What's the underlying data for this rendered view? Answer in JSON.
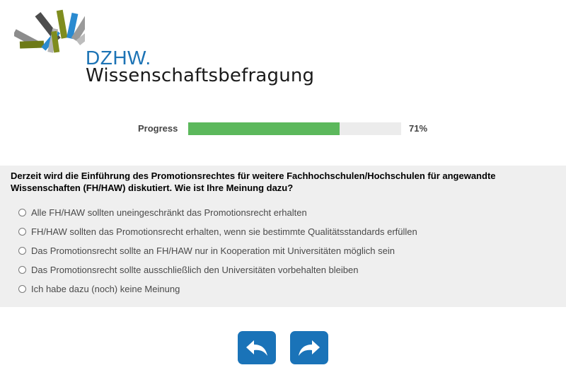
{
  "brand": {
    "short_name": "DZHW.",
    "subtitle": "Wissenschaftsbefragung",
    "color": "#1c73b5"
  },
  "progress": {
    "label": "Progress",
    "percent": 71,
    "value_text": "71%",
    "fill_color": "#5cb85c"
  },
  "question": {
    "text": "Derzeit wird die Einführung des Promotionsrechtes für weitere Fachhochschulen/Hochschulen für angewandte Wissenschaften (FH/HAW) diskutiert. Wie ist Ihre Meinung dazu?",
    "options": [
      {
        "label": "Alle FH/HAW sollten uneingeschränkt das Promotionsrecht erhalten"
      },
      {
        "label": "FH/HAW sollten das Promotionsrecht erhalten, wenn sie bestimmte Qualitätsstandards erfüllen"
      },
      {
        "label": "Das Promotionsrecht sollte an FH/HAW nur in Kooperation mit Universitäten möglich sein"
      },
      {
        "label": "Das Promotionsrecht sollte ausschließlich den Universitäten vorbehalten bleiben"
      },
      {
        "label": "Ich habe dazu (noch) keine Meinung"
      }
    ]
  },
  "navigation": {
    "back_icon": "back-arrow-icon",
    "next_icon": "forward-arrow-icon",
    "button_color": "#1a73b8"
  }
}
